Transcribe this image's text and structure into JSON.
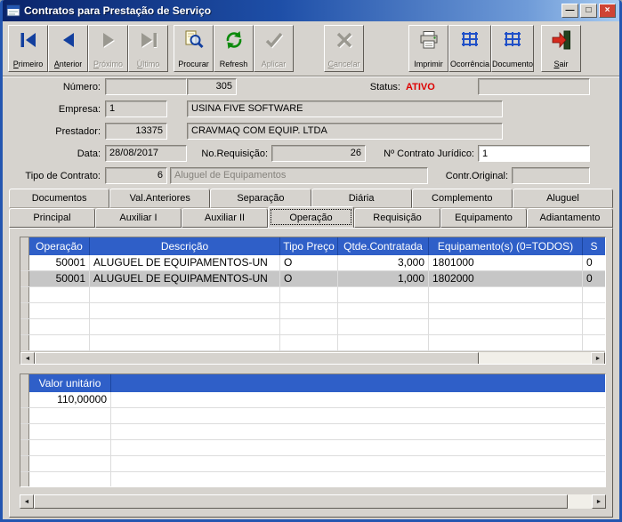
{
  "colors": {
    "titlebar_gradient_start": "#0a246a",
    "titlebar_gradient_end": "#a6caf0",
    "window_background": "#d6d3ce",
    "status_text": "#dd0000",
    "grid_header_background": "#2f5fc8",
    "grid_header_text": "#ffffff",
    "selected_row_background": "#c6c6c6",
    "close_button_background": "#cf4434"
  },
  "icons": {
    "scroll_left": "◄",
    "scroll_right": "►",
    "window_minimize": "—",
    "window_maximize": "□",
    "window_close": "×"
  },
  "window": {
    "title": "Contratos para Prestação de Serviço"
  },
  "toolbar": {
    "buttons": [
      {
        "label": "Primeiro",
        "enabled": true
      },
      {
        "label": "Anterior",
        "enabled": true
      },
      {
        "label": "Próximo",
        "enabled": false
      },
      {
        "label": "Último",
        "enabled": false
      },
      {
        "label": "Procurar",
        "enabled": true
      },
      {
        "label": "Refresh",
        "enabled": true
      },
      {
        "label": "Aplicar",
        "enabled": false
      },
      {
        "label": "Cancelar",
        "enabled": false
      },
      {
        "label": "Imprimir",
        "enabled": true
      },
      {
        "label": "Ocorrência",
        "enabled": true
      },
      {
        "label": "Documento",
        "enabled": true
      },
      {
        "label": "Sair",
        "enabled": true
      }
    ]
  },
  "form": {
    "numero": {
      "label": "Número:",
      "value": "305"
    },
    "status": {
      "label": "Status:",
      "value": "ATIVO"
    },
    "empresa": {
      "label": "Empresa:",
      "code": "1",
      "name": "USINA FIVE SOFTWARE"
    },
    "prestador": {
      "label": "Prestador:",
      "code": "13375",
      "name": "CRAVMAQ COM EQUIP. LTDA"
    },
    "data": {
      "label": "Data:",
      "value": "28/08/2017"
    },
    "requisicao": {
      "label": "No.Requisição:",
      "value": "26"
    },
    "contrato_juridico": {
      "label": "Nº Contrato Jurídico:",
      "value": "1"
    },
    "tipo_contrato": {
      "label": "Tipo de Contrato:",
      "code": "6",
      "name": "Aluguel de Equipamentos"
    },
    "contr_original": {
      "label": "Contr.Original:",
      "value": ""
    }
  },
  "tabs": {
    "row1": [
      {
        "label": "Documentos"
      },
      {
        "label": "Val.Anteriores"
      },
      {
        "label": "Separação"
      },
      {
        "label": "Diária"
      },
      {
        "label": "Complemento"
      },
      {
        "label": "Aluguel"
      }
    ],
    "row2": [
      {
        "label": "Principal"
      },
      {
        "label": "Auxiliar I"
      },
      {
        "label": "Auxiliar II"
      },
      {
        "label": "Operação",
        "selected": true
      },
      {
        "label": "Requisição"
      },
      {
        "label": "Equipamento"
      },
      {
        "label": "Adiantamento"
      }
    ],
    "selected": "Operação"
  },
  "operations_grid": {
    "columns": [
      "Operação",
      "Descrição",
      "Tipo Preço",
      "Qtde.Contratada",
      "Equipamento(s) (0=TODOS)",
      "S"
    ],
    "rows": [
      {
        "operacao": "50001",
        "descricao": "ALUGUEL DE EQUIPAMENTOS-UN",
        "tipo_preco": "O",
        "qtde_contratada": "3,000",
        "equipamentos": "1801000",
        "s": "0",
        "selected": false
      },
      {
        "operacao": "50001",
        "descricao": "ALUGUEL DE EQUIPAMENTOS-UN",
        "tipo_preco": "O",
        "qtde_contratada": "1,000",
        "equipamentos": "1802000",
        "s": "0",
        "selected": true
      }
    ]
  },
  "valor_grid": {
    "columns": [
      "Valor unitário"
    ],
    "rows": [
      {
        "valor_unitario": "110,00000"
      }
    ]
  }
}
